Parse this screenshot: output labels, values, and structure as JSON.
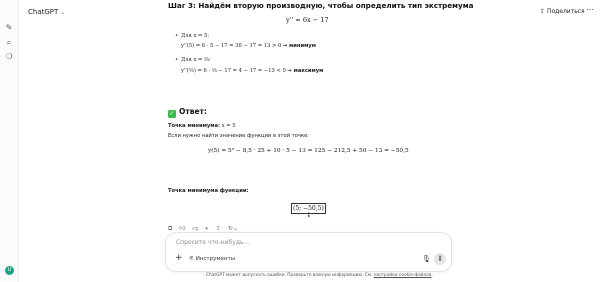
{
  "header": {
    "model_name": "ChatGPT",
    "share_label": "Поделиться"
  },
  "message": {
    "step_title": "Шаг 3: Найдём вторую производную, чтобы определить тип экстремума",
    "second_derivative": "y'' = 6x − 17",
    "bullets": [
      {
        "condition": "Для x = 5:",
        "calc": "y''(5) = 6 · 5 − 17 = 30 − 17 = 13 > 0",
        "result": "→ минимум"
      },
      {
        "condition": "Для x = ⅔:",
        "calc": "y''(⅔) = 6 · ⅔ − 17 = 4 − 17 = −13 < 0",
        "result": "→ максимум"
      }
    ],
    "answer_title": "Ответ:",
    "min_point_label": "Точка минимума:",
    "min_point_value": "x = 5",
    "value_intro": "Если нужно найти значение функции в этой точке:",
    "value_formula": "y(5) = 5³ − 8,5 · 25 + 10 · 5 − 13 = 125 − 212,5 + 50 − 13 = −50,5",
    "min_point_function_label": "Точка минимума функции:",
    "boxed_answer": "(5; −50,5)"
  },
  "composer": {
    "placeholder": "Спросите что-нибудь…",
    "tools_label": "Инструменты"
  },
  "footer": {
    "disclaimer_prefix": "ChatGPT может допускать ошибки. Проверьте важную информацию. См.",
    "disclaimer_link": "настройки cookie-файлов",
    "disclaimer_suffix": "."
  },
  "icons": {
    "sidebar": [
      "new-chat-icon",
      "search-icon",
      "library-icon"
    ],
    "actions": [
      "copy-icon",
      "thumbs-up-icon",
      "thumbs-down-icon",
      "speaker-icon",
      "share-icon",
      "regenerate-icon"
    ]
  }
}
